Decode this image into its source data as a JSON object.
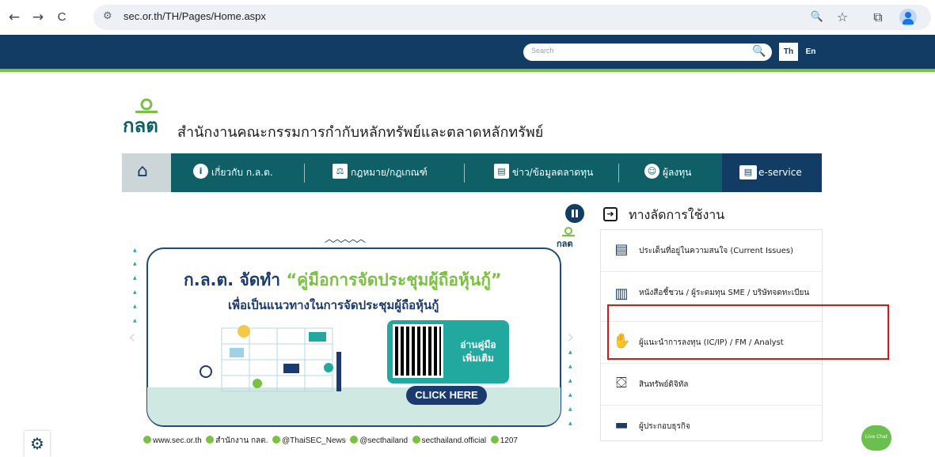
{
  "browser": {
    "back_icon": "←",
    "forward_icon": "→",
    "reload_icon": "C",
    "site_icon": "⚙",
    "url": "sec.or.th/TH/Pages/Home.aspx",
    "zoom_icon": "🔍",
    "star_icon": "☆",
    "extensions_icon": "⧉"
  },
  "site_header": {
    "search_placeholder": "Search",
    "search_icon": "🔍",
    "lang_th": "Th",
    "lang_en": "En"
  },
  "logo": {
    "text": "กลต",
    "subtitle": "สำนักงานคณะกรรมการกำกับหลักทรัพย์และตลาดหลักทรัพย์"
  },
  "menu": {
    "home_icon": "⌂",
    "items": [
      {
        "label": "เกี่ยวกับ ก.ล.ต.",
        "icon": "i"
      },
      {
        "label": "กฎหมาย/กฎเกณฑ์",
        "icon": "⚖"
      },
      {
        "label": "ข่าว/ข้อมูลตลาดทุน",
        "icon": "▤"
      },
      {
        "label": "ผู้ลงทุน",
        "icon": "☺"
      }
    ],
    "eservice": {
      "label": "e-service",
      "icon": "▤"
    }
  },
  "banner": {
    "logo": "กลต",
    "headline_prefix": "ก.ล.ต. จัดทำ",
    "headline_highlight": "“คู่มือการจัดประชุมผู้ถือหุ้นกู้”",
    "subheadline": "เพื่อเป็นแนวทางในการจัดประชุมผู้ถือหุ้นกู้",
    "qr_cta_line1": "อ่านคู่มือ",
    "qr_cta_line2": "เพิ่มเติม",
    "click_here": "CLICK HERE",
    "footer": {
      "website": "www.sec.or.th",
      "facebook": "สำนักงาน กลต.",
      "twitter": "@ThaiSEC_News",
      "line": "@secthailand",
      "instagram": "secthailand.official",
      "hotline": "1207"
    }
  },
  "shortcuts": {
    "title": "ทางลัดการใช้งาน",
    "items": [
      {
        "label": "ประเด็นที่อยู่ในความสนใจ (Current Issues)",
        "icon": "▤"
      },
      {
        "label": "หนังสือชี้ชวน / ผู้ระดมทุน SME / บริษัทจดทะเบียน",
        "icon": "▥"
      },
      {
        "label": "ผู้แนะนำการลงทุน (IC/IP) / FM / Analyst",
        "icon": "✋"
      },
      {
        "label": "สินทรัพย์ดิจิทัล",
        "icon": "⛋"
      },
      {
        "label": "ผู้ประกอบธุรกิจ",
        "icon": "▬"
      }
    ]
  },
  "floating": {
    "settings_icon": "⚙",
    "live_chat": "Live Chat"
  },
  "colors": {
    "navy": "#123c64",
    "teal": "#0f5f67",
    "green": "#7ac143",
    "highlight": "#d11a1a"
  }
}
